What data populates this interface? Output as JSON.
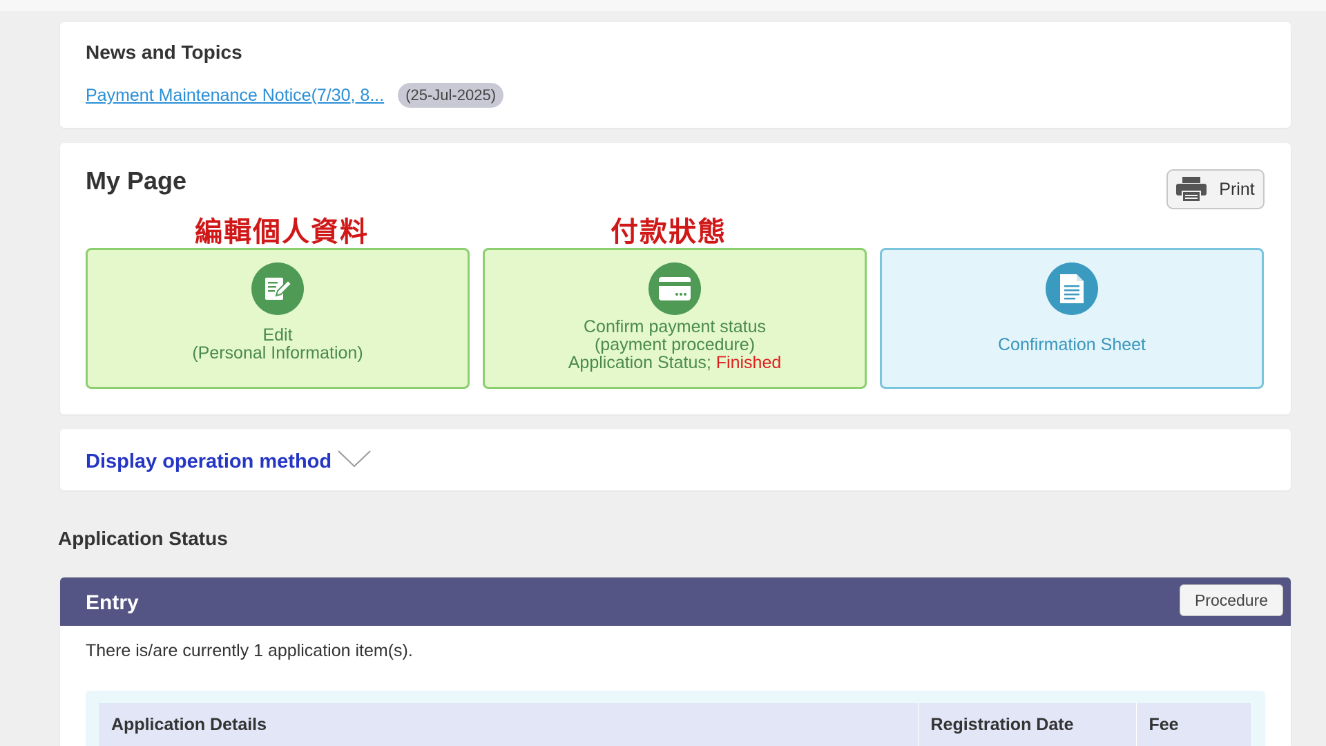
{
  "news": {
    "title": "News and Topics",
    "link": "Payment Maintenance Notice(7/30, 8...",
    "date": "(25-Jul-2025)"
  },
  "mypage": {
    "title": "My Page",
    "print_label": "Print",
    "annotations": [
      "編輯個人資料",
      "付款狀態"
    ],
    "tiles": [
      {
        "line1": "Edit",
        "line2": "(Personal Information)",
        "icon": "edit-icon"
      },
      {
        "line1": "Confirm payment status",
        "line2": "(payment procedure)",
        "status_prefix": "Application Status;",
        "status_value": "Finished",
        "icon": "credit-card-icon"
      },
      {
        "line1": "Confirmation Sheet",
        "icon": "document-icon"
      }
    ]
  },
  "operation": {
    "label": "Display operation method"
  },
  "application_status": {
    "title": "Application Status",
    "entry": {
      "title": "Entry",
      "procedure_label": "Procedure",
      "count_text": "There is/are currently 1 application item(s).",
      "columns": [
        "Application Details",
        "Registration Date",
        "Fee"
      ]
    }
  },
  "colors": {
    "accent_link": "#2b8fd6",
    "header_bar": "#555585",
    "annotation_red": "#d01818",
    "status_red": "#e02020"
  }
}
